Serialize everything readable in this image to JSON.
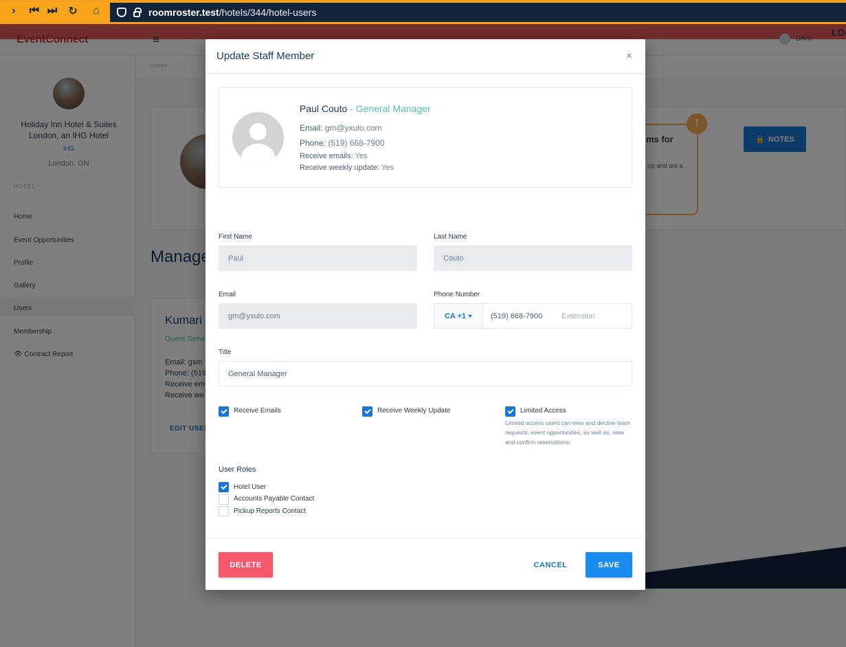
{
  "browser": {
    "url_host": "roomroster.test",
    "url_path": "/hotels/344/hotel-users"
  },
  "app": {
    "brand": "EventConnect",
    "user_name": "DANI",
    "logout": "LOG"
  },
  "sidebar": {
    "hotel_name": "Holiday Inn Hotel & Suites London, an IHG Hotel",
    "hotel_brand": "IHG",
    "hotel_location": "London, ON",
    "section_label": "HOTEL",
    "items": [
      {
        "label": "Home"
      },
      {
        "label": "Event Opportunities"
      },
      {
        "label": "Profile"
      },
      {
        "label": "Gallery"
      },
      {
        "label": "Users"
      },
      {
        "label": "Membership"
      },
      {
        "label": "Contract Report"
      }
    ]
  },
  "background": {
    "breadcrumb": "USERS",
    "alert_title": "ms for",
    "alert_text": "-up and are a",
    "notes_label": "NOTES",
    "manage_title": "Manage",
    "card_name": "Kumari",
    "card_role": "Guest Servi",
    "card_lines": [
      "Email: gsm",
      "Phone: (519",
      "Receive em",
      "Receive we"
    ],
    "edit_user": "EDIT USER"
  },
  "modal": {
    "title": "Update Staff Member",
    "close": "×",
    "profile": {
      "name": "Paul Couto",
      "separator": " - ",
      "role": "General Manager",
      "email_label": "Email:",
      "email": "gm@yxulo.com",
      "phone_label": "Phone:",
      "phone": "(519) 668-7900",
      "receive_emails_label": "Receive emails:",
      "receive_emails": "Yes",
      "receive_weekly_label": "Receive weekly update:",
      "receive_weekly": "Yes"
    },
    "form": {
      "first_name_label": "First Name",
      "first_name": "Paul",
      "last_name_label": "Last Name",
      "last_name": "Couto",
      "email_label": "Email",
      "email": "gm@yxulo.com",
      "phone_label": "Phone Number",
      "country_code": "CA +1",
      "phone": "(519) 668-7900",
      "extension_placeholder": "Extension",
      "title_label": "Title",
      "title": "General Manager"
    },
    "options": {
      "receive_emails": {
        "label": "Receive Emails",
        "checked": true
      },
      "receive_weekly": {
        "label": "Receive Weekly Update",
        "checked": true
      },
      "limited_access": {
        "label": "Limited Access",
        "checked": true
      },
      "limited_access_help": "Limited access users can view and decline team requests, event opportunities, as well as, view and confirm reservations."
    },
    "roles": {
      "title": "User Roles",
      "items": [
        {
          "label": "Hotel User",
          "checked": true
        },
        {
          "label": "Accounts Payable Contact",
          "checked": false
        },
        {
          "label": "Pickup Reports Contact",
          "checked": false
        }
      ]
    },
    "buttons": {
      "delete": "DELETE",
      "cancel": "CANCEL",
      "save": "SAVE"
    }
  },
  "colors": {
    "primary": "#1a8cf0",
    "danger": "#f3586b",
    "accent_teal": "#4fc1b5",
    "navy": "#13233a",
    "browser_orange": "#f8a51b"
  }
}
